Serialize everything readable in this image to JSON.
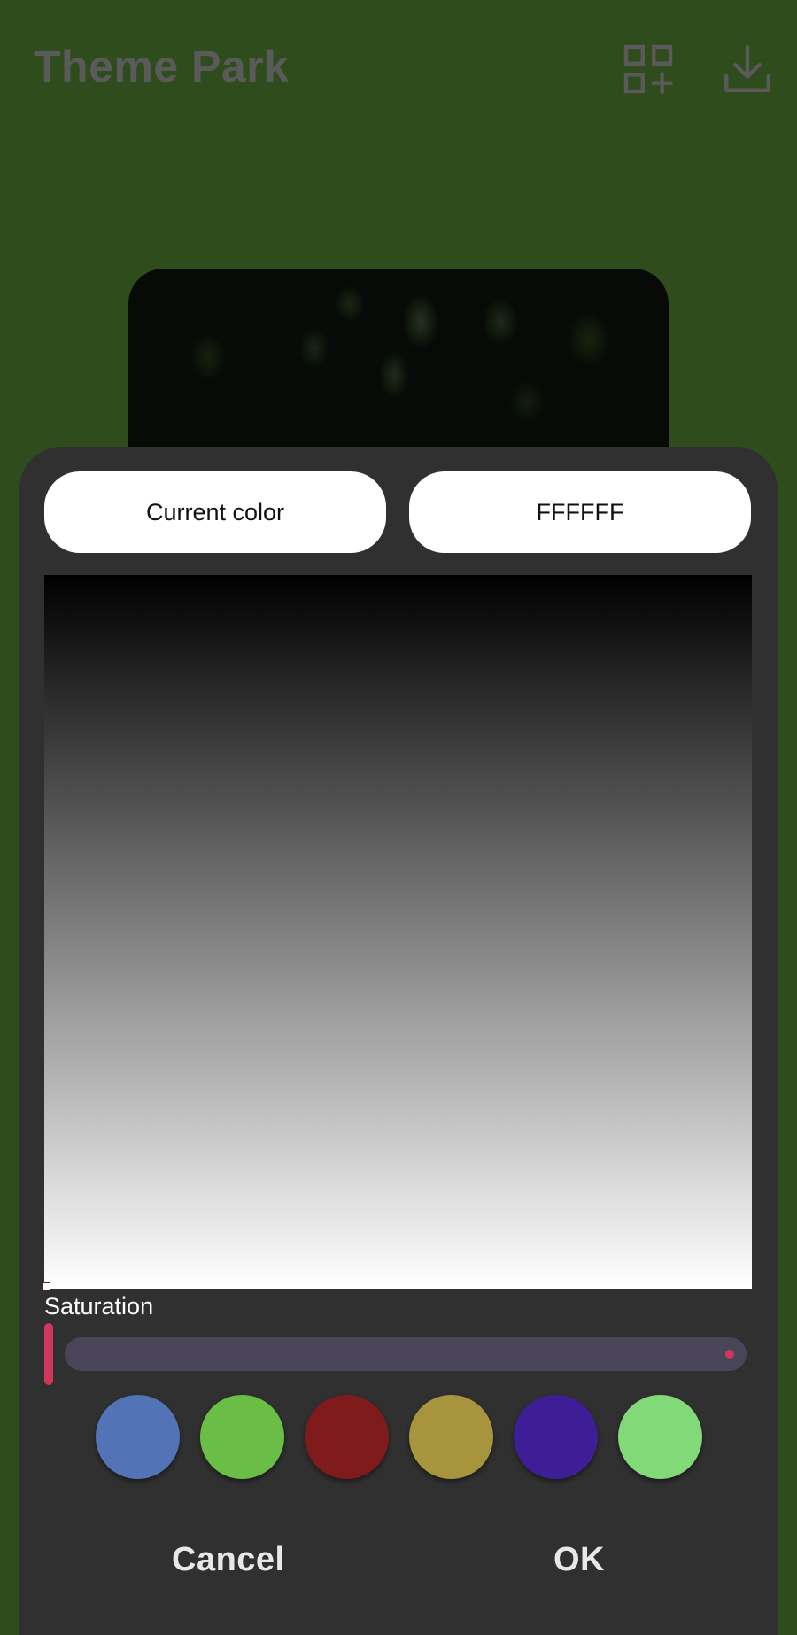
{
  "app_bar": {
    "title": "Theme Park",
    "icons": [
      "qr-add-icon",
      "download-icon"
    ]
  },
  "dialog": {
    "current_color_label": "Current color",
    "hex_value": "FFFFFF",
    "saturation_label": "Saturation",
    "saturation_value": 1.0,
    "swatches": [
      {
        "name": "blue",
        "color": "#5273b5"
      },
      {
        "name": "green",
        "color": "#6abe45"
      },
      {
        "name": "red",
        "color": "#7f1b1b"
      },
      {
        "name": "gold",
        "color": "#a8943c"
      },
      {
        "name": "purple",
        "color": "#3d1e96"
      },
      {
        "name": "light-green",
        "color": "#82d977"
      }
    ],
    "cancel_label": "Cancel",
    "ok_label": "OK"
  },
  "colors": {
    "background": "#2f4c1c",
    "dialog": "#303030",
    "accent": "#d1365d"
  }
}
